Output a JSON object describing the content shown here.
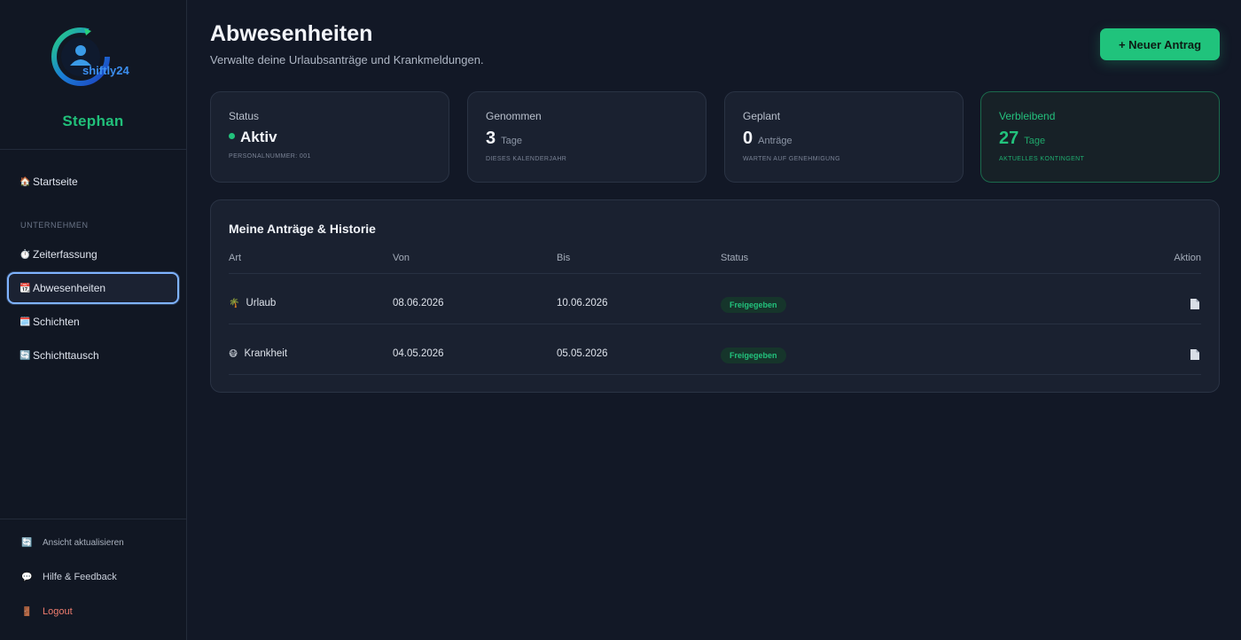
{
  "sidebar": {
    "logo_text": "shiftly24",
    "user_name": "Stephan",
    "section_label": "UNTERNEHMEN",
    "items": [
      {
        "label": "Startseite",
        "icon": "🏠"
      },
      {
        "label": "Zeiterfassung",
        "icon": "⏱️"
      },
      {
        "label": "Abwesenheiten",
        "icon": "📆"
      },
      {
        "label": "Schichten",
        "icon": "🗓️"
      },
      {
        "label": "Schichttausch",
        "icon": "🔄"
      }
    ],
    "bottom": [
      {
        "label": "Ansicht aktualisieren",
        "icon": "🔄"
      },
      {
        "label": "Hilfe & Feedback",
        "icon": "💬"
      },
      {
        "label": "Logout",
        "icon": "🚪"
      }
    ]
  },
  "header": {
    "title": "Abwesenheiten",
    "subtitle": "Verwalte deine Urlaubsanträge und Krankmeldungen.",
    "new_button": "+ Neuer Antrag"
  },
  "cards": [
    {
      "label": "Status",
      "value": "Aktiv",
      "unit": "",
      "note": "PERSONALNUMMER: 001"
    },
    {
      "label": "Genommen",
      "value": "3",
      "unit": "Tage",
      "note": "DIESES KALENDERJAHR"
    },
    {
      "label": "Geplant",
      "value": "0",
      "unit": "Anträge",
      "note": "WARTEN AUF GENEHMIGUNG"
    },
    {
      "label": "Verbleibend",
      "value": "27",
      "unit": "Tage",
      "note": "AKTUELLES KONTINGENT"
    }
  ],
  "history": {
    "title": "Meine Anträge & Historie",
    "columns": [
      "Art",
      "Von",
      "Bis",
      "Status",
      "Aktion"
    ],
    "rows": [
      {
        "type": "Urlaub",
        "emoji": "🌴",
        "from": "08.06.2026",
        "to": "10.06.2026",
        "status": "Freigegeben"
      },
      {
        "type": "Krankheit",
        "emoji": "😷",
        "from": "04.05.2026",
        "to": "05.05.2026",
        "status": "Freigegeben"
      }
    ]
  },
  "colors": {
    "accent": "#20c37c",
    "background": "#121826",
    "card": "#1a2130"
  }
}
